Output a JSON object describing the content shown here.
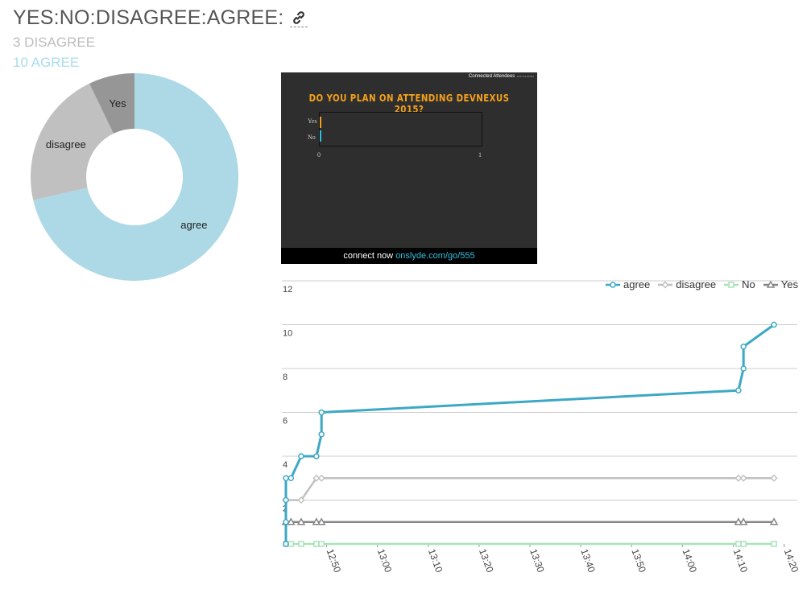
{
  "header": {
    "title": "YES:NO:DISAGREE:AGREE:",
    "disagree_line": "3 DISAGREE",
    "agree_line": "10 AGREE"
  },
  "slide": {
    "header_text": "Connected Attendees",
    "header_small": "12:07:43 2015/1",
    "question": "DO YOU PLAN ON ATTENDING DEVNEXUS 2015?",
    "categories": [
      "Yes",
      "No"
    ],
    "ticks": [
      "0",
      "1"
    ],
    "footer_prefix": "connect now",
    "footer_url": "onslyde.com/go/555",
    "accent": "#f4a11c",
    "url_color": "#2fc1e3"
  },
  "chart_data": [
    {
      "type": "pie",
      "donut": true,
      "labels": [
        "agree",
        "disagree",
        "Yes"
      ],
      "values": [
        10,
        3,
        1
      ],
      "colors": [
        "#add8e6",
        "#c0c0c0",
        "#969696"
      ]
    },
    {
      "type": "line",
      "ylim": [
        0,
        12
      ],
      "yticks": [
        "2",
        "4",
        "6",
        "8",
        "10",
        "12"
      ],
      "xticks": [
        "12:50",
        "13:00",
        "13:10",
        "13:20",
        "13:30",
        "13:40",
        "13:50",
        "14:00",
        "14:10",
        "14:20"
      ],
      "xlim": [
        "12:42",
        "14:21"
      ],
      "legend": "top-right",
      "series": [
        {
          "name": "agree",
          "color": "#3da8c6",
          "points": [
            [
              "12:42",
              0
            ],
            [
              "12:42",
              1
            ],
            [
              "12:42",
              2
            ],
            [
              "12:42",
              3
            ],
            [
              "12:43",
              3
            ],
            [
              "12:45",
              4
            ],
            [
              "12:48",
              4
            ],
            [
              "12:49",
              5
            ],
            [
              "12:49",
              6
            ],
            [
              "14:11",
              7
            ],
            [
              "14:12",
              8
            ],
            [
              "14:12",
              9
            ],
            [
              "14:18",
              10
            ]
          ]
        },
        {
          "name": "disagree",
          "color": "#c0c0c0",
          "points": [
            [
              "12:42",
              2
            ],
            [
              "12:45",
              2
            ],
            [
              "12:48",
              3
            ],
            [
              "12:49",
              3
            ],
            [
              "14:11",
              3
            ],
            [
              "14:12",
              3
            ],
            [
              "14:18",
              3
            ]
          ]
        },
        {
          "name": "No",
          "color": "#a8e3b8",
          "points": [
            [
              "12:42",
              0
            ],
            [
              "12:43",
              0
            ],
            [
              "12:45",
              0
            ],
            [
              "12:48",
              0
            ],
            [
              "12:49",
              0
            ],
            [
              "14:11",
              0
            ],
            [
              "14:12",
              0
            ],
            [
              "14:18",
              0
            ]
          ]
        },
        {
          "name": "Yes",
          "color": "#858585",
          "points": [
            [
              "12:42",
              1
            ],
            [
              "12:43",
              1
            ],
            [
              "12:45",
              1
            ],
            [
              "12:48",
              1
            ],
            [
              "12:49",
              1
            ],
            [
              "14:11",
              1
            ],
            [
              "14:12",
              1
            ],
            [
              "14:18",
              1
            ]
          ]
        }
      ]
    }
  ]
}
